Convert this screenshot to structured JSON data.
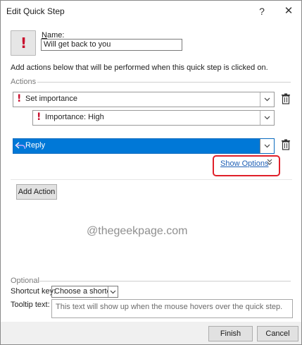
{
  "window": {
    "title": "Edit Quick Step",
    "help_glyph": "?",
    "close_glyph": "✕"
  },
  "quickstep": {
    "icon": "exclamation-icon",
    "name_label": "Name:",
    "name_value": "Will get back to you",
    "instructions": "Add actions below that will be performed when this quick step is clicked on."
  },
  "actions": {
    "section_label": "Actions",
    "action1": {
      "label": "Set importance",
      "icon": "exclamation-icon"
    },
    "action1_option": {
      "label": "Importance: High",
      "icon": "exclamation-icon"
    },
    "action2": {
      "label": "Reply",
      "icon": "reply-arrow-icon",
      "selected": true
    },
    "show_options": "Show Options",
    "show_options_chevron": "»",
    "add_action": "Add Action"
  },
  "watermark": "@thegeekpage.com",
  "optional": {
    "section_label": "Optional",
    "shortcut_label": "Shortcut key:",
    "shortcut_value": "Choose a shortcut",
    "tooltip_label": "Tooltip text:",
    "tooltip_value": "This text will show up when the mouse hovers over the quick step."
  },
  "footer": {
    "finish": "Finish",
    "cancel": "Cancel"
  },
  "colors": {
    "selected_row": "#0078d7",
    "importance": "#c8102e",
    "highlight_box": "#e0202a",
    "link": "#1e5fb5"
  }
}
